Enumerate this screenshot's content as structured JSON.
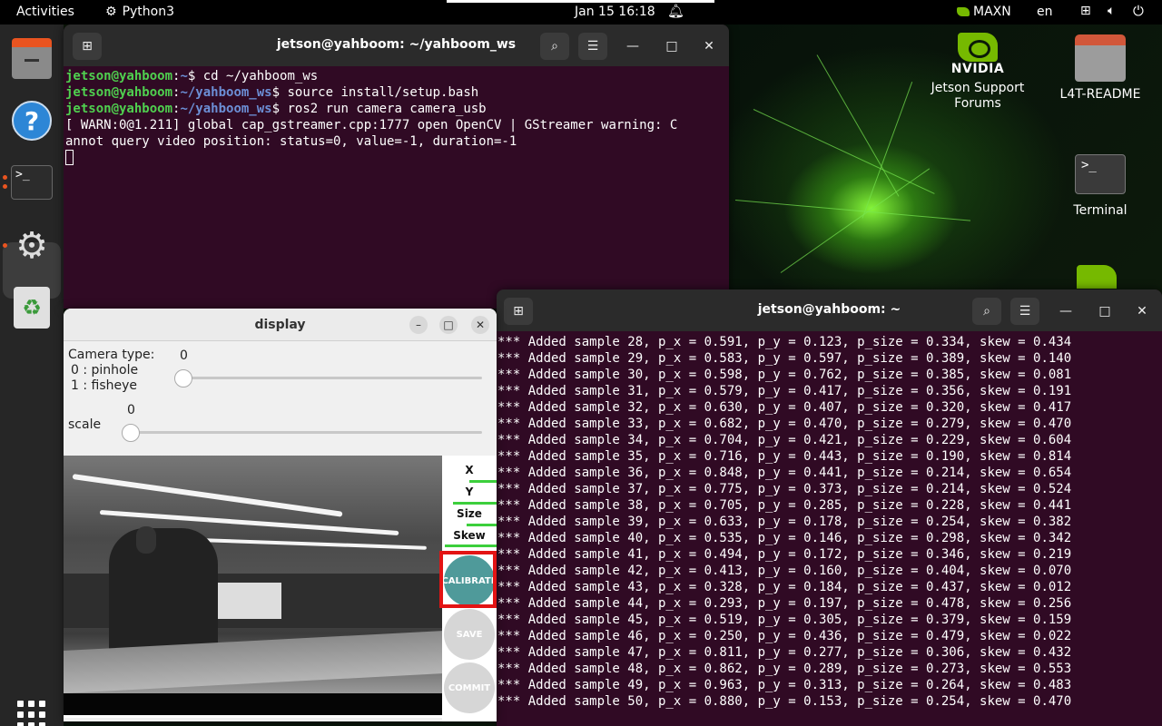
{
  "topbar": {
    "activities": "Activities",
    "app_name": "Python3",
    "clock": "Jan 15  16:18",
    "power_mode": "MAXN",
    "language": "en"
  },
  "dock": {
    "items": [
      "files-icon",
      "help-icon",
      "terminal-icon",
      "settings-icon",
      "trash-icon",
      "show-apps-icon"
    ]
  },
  "desktop": {
    "nvidia_word": "NVIDIA",
    "icons": [
      {
        "label": "Jetson Support Forums",
        "icon": "nvidia-logo-icon"
      },
      {
        "label": "L4T-README",
        "icon": "folder-icon"
      },
      {
        "label": "Terminal",
        "icon": "terminal-icon"
      }
    ]
  },
  "terminal1": {
    "title": "jetson@yahboom: ~/yahboom_ws",
    "prompt_user": "jetson@yahboom",
    "lines": [
      {
        "path": "~",
        "cmd": "$ cd ~/yahboom_ws"
      },
      {
        "path": "~/yahboom_ws",
        "cmd": "$ source install/setup.bash"
      },
      {
        "path": "~/yahboom_ws",
        "cmd": "$ ros2 run camera camera_usb"
      }
    ],
    "output": [
      "[ WARN:0@1.211] global cap_gstreamer.cpp:1777 open OpenCV | GStreamer warning: C",
      "annot query video position: status=0, value=-1, duration=-1"
    ]
  },
  "terminal2": {
    "title": "jetson@yahboom: ~",
    "lines": [
      "*** Added sample 28, p_x = 0.591, p_y = 0.123, p_size = 0.334, skew = 0.434",
      "*** Added sample 29, p_x = 0.583, p_y = 0.597, p_size = 0.389, skew = 0.140",
      "*** Added sample 30, p_x = 0.598, p_y = 0.762, p_size = 0.385, skew = 0.081",
      "*** Added sample 31, p_x = 0.579, p_y = 0.417, p_size = 0.356, skew = 0.191",
      "*** Added sample 32, p_x = 0.630, p_y = 0.407, p_size = 0.320, skew = 0.417",
      "*** Added sample 33, p_x = 0.682, p_y = 0.470, p_size = 0.279, skew = 0.470",
      "*** Added sample 34, p_x = 0.704, p_y = 0.421, p_size = 0.229, skew = 0.604",
      "*** Added sample 35, p_x = 0.716, p_y = 0.443, p_size = 0.190, skew = 0.814",
      "*** Added sample 36, p_x = 0.848, p_y = 0.441, p_size = 0.214, skew = 0.654",
      "*** Added sample 37, p_x = 0.775, p_y = 0.373, p_size = 0.214, skew = 0.524",
      "*** Added sample 38, p_x = 0.705, p_y = 0.285, p_size = 0.228, skew = 0.441",
      "*** Added sample 39, p_x = 0.633, p_y = 0.178, p_size = 0.254, skew = 0.382",
      "*** Added sample 40, p_x = 0.535, p_y = 0.146, p_size = 0.298, skew = 0.342",
      "*** Added sample 41, p_x = 0.494, p_y = 0.172, p_size = 0.346, skew = 0.219",
      "*** Added sample 42, p_x = 0.413, p_y = 0.160, p_size = 0.404, skew = 0.070",
      "*** Added sample 43, p_x = 0.328, p_y = 0.184, p_size = 0.437, skew = 0.012",
      "*** Added sample 44, p_x = 0.293, p_y = 0.197, p_size = 0.478, skew = 0.256",
      "*** Added sample 45, p_x = 0.519, p_y = 0.305, p_size = 0.379, skew = 0.159",
      "*** Added sample 46, p_x = 0.250, p_y = 0.436, p_size = 0.479, skew = 0.022",
      "*** Added sample 47, p_x = 0.811, p_y = 0.277, p_size = 0.306, skew = 0.432",
      "*** Added sample 48, p_x = 0.862, p_y = 0.289, p_size = 0.273, skew = 0.553",
      "*** Added sample 49, p_x = 0.963, p_y = 0.313, p_size = 0.264, skew = 0.483",
      "*** Added sample 50, p_x = 0.880, p_y = 0.153, p_size = 0.254, skew = 0.470"
    ]
  },
  "display": {
    "title": "display",
    "camera_type_label": "Camera type:",
    "camera_type_value": "0",
    "camera_type_options": [
      "0 : pinhole",
      "1 : fisheye"
    ],
    "scale_label": "scale",
    "scale_value": "0",
    "metrics": [
      "X",
      "Y",
      "Size",
      "Skew"
    ],
    "metric_progress": [
      0.5,
      0.8,
      0.55,
      0.95
    ],
    "buttons": {
      "calibrate": "CALIBRATE",
      "save": "SAVE",
      "commit": "COMMIT"
    },
    "calibrate_color": "#4f9a9a"
  }
}
